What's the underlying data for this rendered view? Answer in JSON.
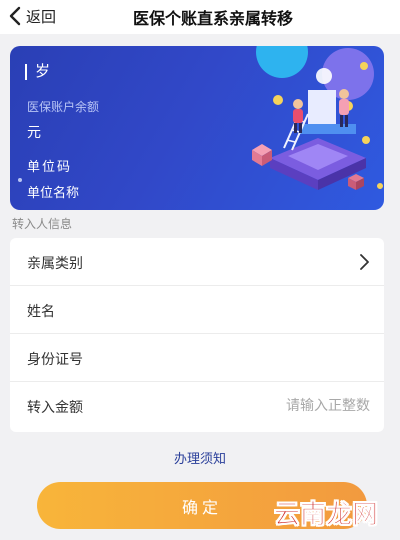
{
  "nav": {
    "back_label": "返回",
    "title": "医保个账直系亲属转移"
  },
  "card": {
    "age_label": "岁",
    "balance_label": "医保账户余额",
    "balance_value": "元",
    "unit_code_label": "单位码",
    "unit_name_label": "单位名称"
  },
  "form": {
    "section_label": "转入人信息",
    "rows": [
      {
        "label": "亲属类别",
        "icon": "chevron-right-icon"
      },
      {
        "label": "姓名"
      },
      {
        "label": "身份证号"
      },
      {
        "label": "转入金额",
        "placeholder": "请输入正整数"
      }
    ]
  },
  "footer": {
    "notice_link": "办理须知",
    "confirm_label": "确定",
    "watermark": "云南龙网"
  },
  "colors": {
    "card_gradient_start": "#2a3fb5",
    "card_gradient_end": "#2f5ae0",
    "button_gradient_start": "#f8b53a",
    "button_gradient_end": "#f29a3f",
    "link": "#2a3f9a",
    "watermark": "#cc1e1e"
  }
}
